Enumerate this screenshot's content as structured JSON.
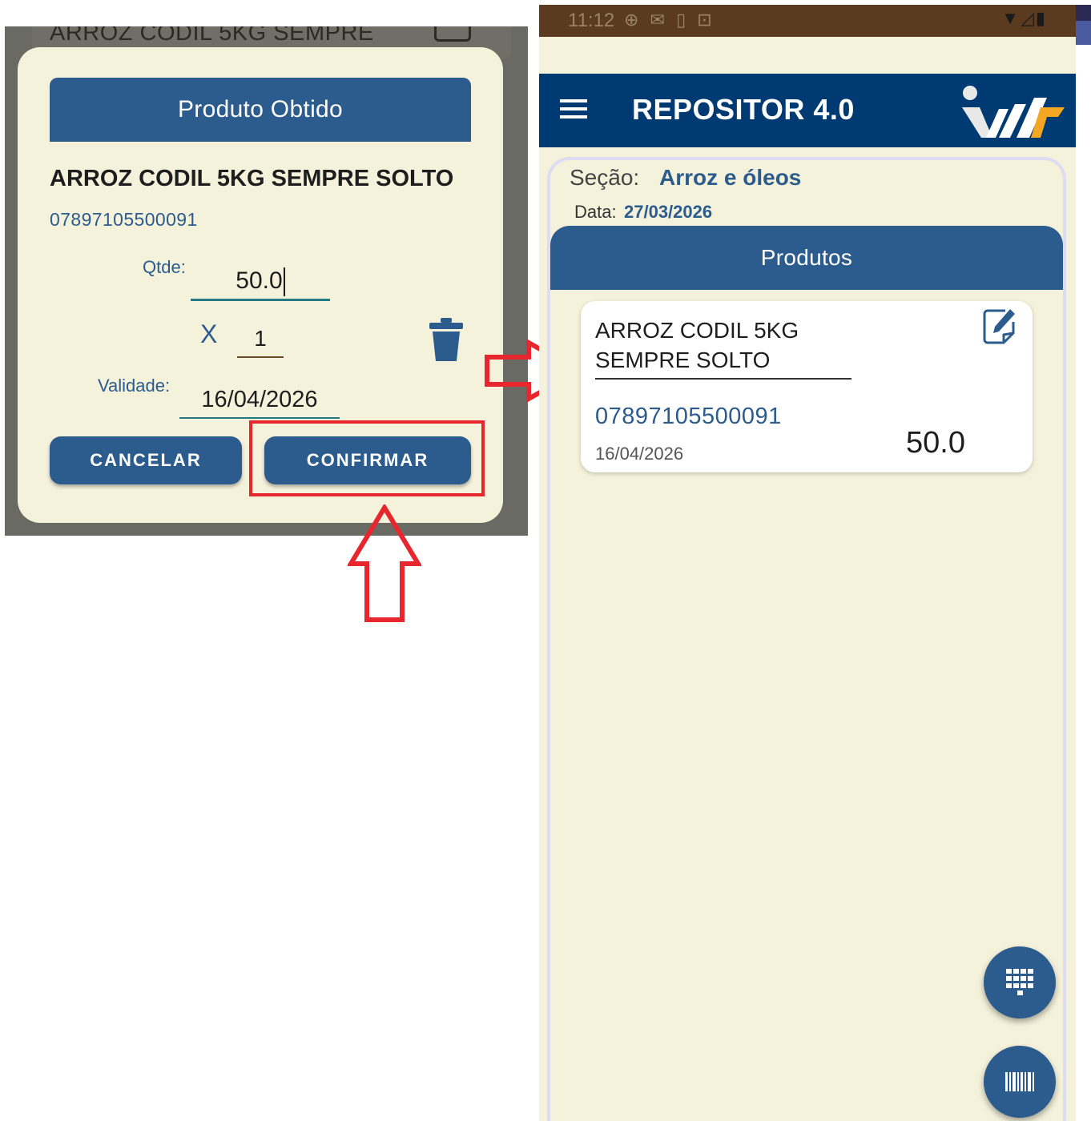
{
  "dialog": {
    "background_title": "ARROZ CODIL 5KG SEMPRE",
    "header": "Produto Obtido",
    "product_name": "ARROZ CODIL 5KG SEMPRE SOLTO",
    "barcode": "07897105500091",
    "qtde_label": "Qtde:",
    "qtde_value": "50.0",
    "multiplier_sign": "X",
    "multiplier_value": "1",
    "validade_label": "Validade:",
    "validade_value": "16/04/2026",
    "cancel_label": "CANCELAR",
    "confirm_label": "CONFIRMAR"
  },
  "status_bar": {
    "time": "11:12"
  },
  "app_bar": {
    "title": "REPOSITOR 4.0"
  },
  "section": {
    "label": "Seção:",
    "value": "Arroz e óleos",
    "date_label": "Data:",
    "date_value": "27/03/2026"
  },
  "products": {
    "header": "Produtos",
    "items": [
      {
        "name": "ARROZ CODIL 5KG SEMPRE SOLTO",
        "barcode": "07897105500091",
        "expiry": "16/04/2026",
        "quantity": "50.0"
      }
    ]
  },
  "icons": {
    "trash": "trash-icon",
    "menu": "menu-icon",
    "edit": "edit-note-icon",
    "keypad": "keypad-icon",
    "barcode": "barcode-icon",
    "logo": "app-logo"
  },
  "colors": {
    "primary_blue": "#2c5b8d",
    "app_bar_blue": "#003a73",
    "cream_bg": "#f5f2dc",
    "highlight_red": "#e8262d",
    "logo_orange": "#f5a623"
  }
}
